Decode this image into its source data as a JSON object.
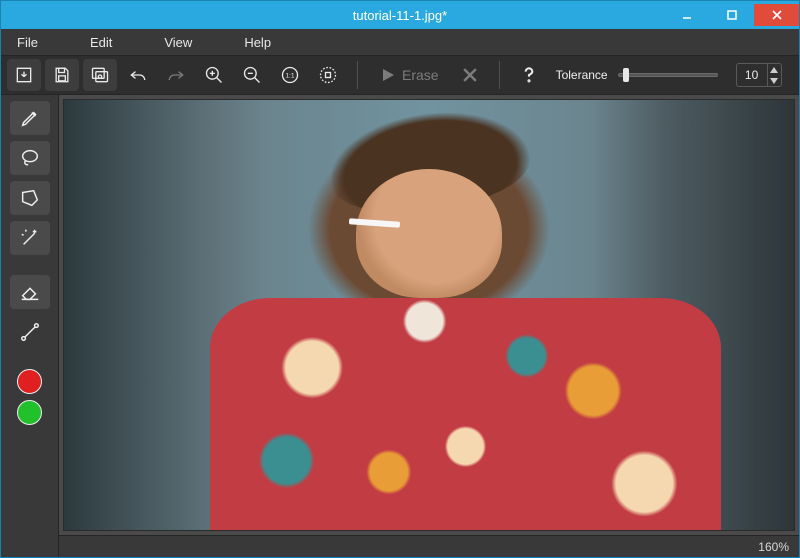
{
  "window": {
    "title": "tutorial-11-1.jpg*"
  },
  "menu": {
    "file": "File",
    "edit": "Edit",
    "view": "View",
    "help": "Help"
  },
  "toolbar": {
    "erase_label": "Erase",
    "tolerance_label": "Tolerance",
    "tolerance_value": "10"
  },
  "icons": {
    "open": "open-icon",
    "save": "save-icon",
    "view_original": "view-original-icon",
    "undo": "undo-icon",
    "redo": "redo-icon",
    "zoom_in": "zoom-in-icon",
    "zoom_out": "zoom-out-icon",
    "zoom_actual": "zoom-actual-icon",
    "zoom_fit": "zoom-fit-icon",
    "play": "play-icon",
    "cancel": "cancel-icon",
    "help": "help-icon"
  },
  "tools": {
    "marker": "marker-tool",
    "lasso": "lasso-tool",
    "polygon": "polygon-tool",
    "magic_wand": "magic-wand-tool",
    "eraser": "eraser-tool",
    "line": "line-tool"
  },
  "colors": {
    "red": "#e02020",
    "green": "#22c02a"
  },
  "status": {
    "zoom": "160%"
  }
}
